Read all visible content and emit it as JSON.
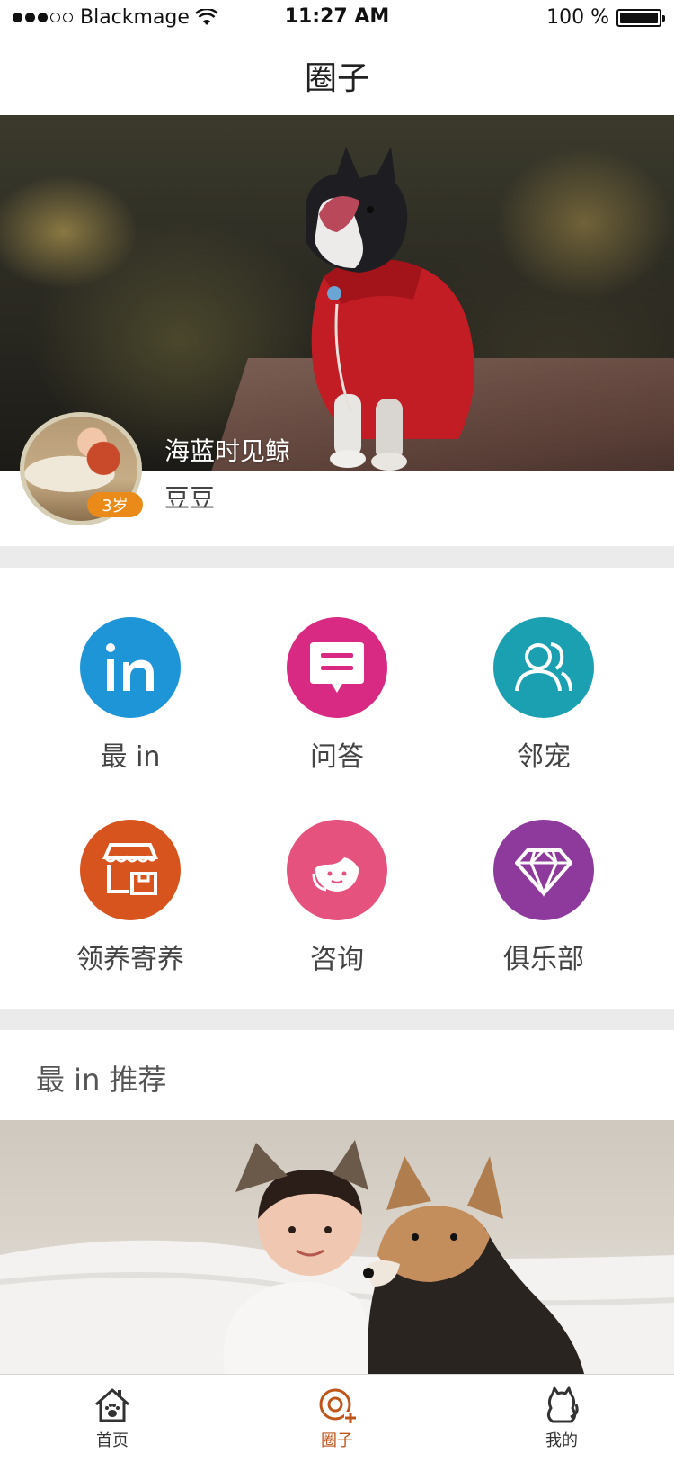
{
  "status_bar": {
    "carrier": "Blackmage",
    "time": "11:27 AM",
    "battery": "100 %",
    "signal_bars": 3
  },
  "nav": {
    "title": "圈子"
  },
  "profile": {
    "username": "海蓝时见鲸",
    "pet_name": "豆豆",
    "age_badge": "3岁"
  },
  "menu": {
    "items": [
      {
        "label": "最 in",
        "icon": "in-icon",
        "color": "#1d95d6"
      },
      {
        "label": "问答",
        "icon": "chat-bubble-icon",
        "color": "#d82a82"
      },
      {
        "label": "邻宠",
        "icon": "users-icon",
        "color": "#1aa0b0"
      },
      {
        "label": "领养寄养",
        "icon": "shop-box-icon",
        "color": "#d8541e"
      },
      {
        "label": "咨询",
        "icon": "support-agent-icon",
        "color": "#e5527e"
      },
      {
        "label": "俱乐部",
        "icon": "diamond-icon",
        "color": "#8e3a9c"
      }
    ]
  },
  "recommend": {
    "title": "最 in 推荐"
  },
  "tab_bar": {
    "accent": "#c0551c",
    "tabs": [
      {
        "label": "首页",
        "icon": "home-paw-icon"
      },
      {
        "label": "圈子",
        "icon": "circle-plus-icon",
        "active": true
      },
      {
        "label": "我的",
        "icon": "cat-icon"
      }
    ]
  }
}
